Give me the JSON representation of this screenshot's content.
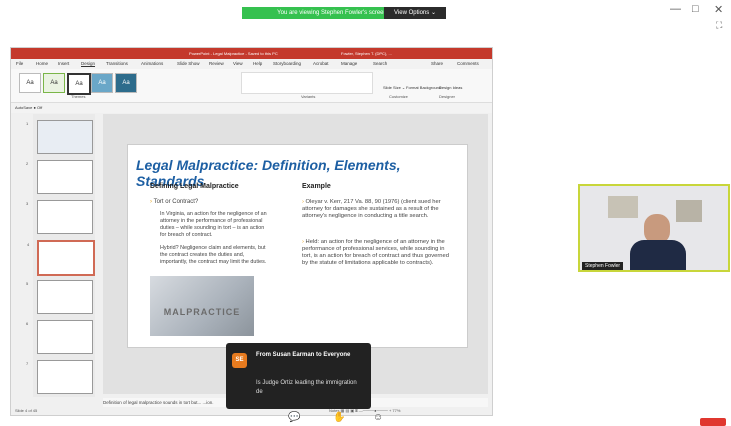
{
  "banner": {
    "text": "You are viewing Stephen Fowler's screen",
    "view_options": "View Options ⌄"
  },
  "window_controls": [
    "—",
    "□",
    "✕",
    "⛶"
  ],
  "ppt": {
    "title": "PowerPoint  -  Legal Malpractice  -  Saved to this PC",
    "account": "Fowler, Stephen T. (DPC), ...",
    "menu": [
      "File",
      "Home",
      "Insert",
      "Design",
      "Transitions",
      "Animations",
      "Slide Show",
      "Review",
      "View",
      "Help",
      "Storyboarding",
      "Acrobat",
      "Manage",
      "Search",
      "Share",
      "Comments"
    ],
    "themes": [
      "Aa",
      "Aa",
      "Aa",
      "Aa",
      "Aa"
    ],
    "ribbon_groups": [
      "Themes",
      "Variants",
      "Customize",
      "Designer"
    ],
    "ribbon_buttons": [
      "Slide Size ⌄",
      "Format Background",
      "Design Ideas"
    ],
    "autosave": "AutoSave ● Off",
    "slide": {
      "title": "Legal Malpractice: Definition, Elements, Standards",
      "left_heading": "Defining Legal Malpractice",
      "left_bullet1": "Tort or Contract?",
      "left_sub1": "In Virginia, an action for the negligence of an attorney in the performance of professional duties – while sounding in tort – is an action for breach of contract.",
      "left_sub2": "Hybrid? Negligence claim and elements, but the contract creates the duties and, importantly, the contract may limit the duties.",
      "photo_label": "MALPRACTICE",
      "right_heading": "Example",
      "right_bullet1": "Oleyar v. Kerr, 217 Va. 88, 90 (1976) (client sued her attorney for damages she sustained as a result of the attorney's negligence in conducting a title search.",
      "right_bullet2": "Held: an action for the negligence of an attorney in the performance of professional services, while sounding in tort, is an action for breach of contract and thus governed by the statute of limitations applicable to contracts)."
    },
    "notes": "Definition of legal malpractice sounds in tort but...                                                   ...ion.",
    "status_left": "Slide 4 of 45",
    "status_right": "Notes    ▦  ▤  ▣  ⌸    —────●──── +   77%",
    "thumb_numbers": [
      "1",
      "2",
      "3",
      "4",
      "5",
      "6",
      "7"
    ]
  },
  "video": {
    "name": "Stephen Fowler"
  },
  "chat": {
    "avatar": "SE",
    "header": "From Susan Earman to Everyone",
    "message": "Is Judge Ortiz leading the immigration de"
  }
}
